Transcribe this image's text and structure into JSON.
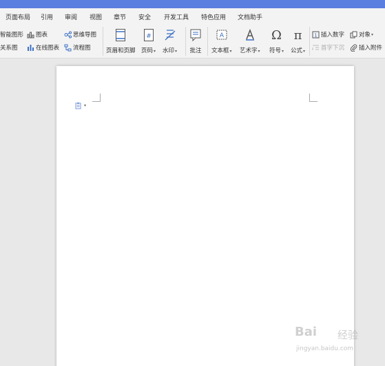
{
  "menu": {
    "tabs": [
      "页面布局",
      "引用",
      "审阅",
      "视图",
      "章节",
      "安全",
      "开发工具",
      "特色应用",
      "文档助手"
    ]
  },
  "ribbon": {
    "smart_shape": "智能图形",
    "relation_chart": "关系图",
    "chart": "图表",
    "online_chart": "在线图表",
    "mind_map": "思维导图",
    "flowchart": "流程图",
    "header_footer": "页眉和页脚",
    "page_number": "页码",
    "watermark": "水印",
    "comment": "批注",
    "text_box": "文本框",
    "word_art": "艺术字",
    "symbol": "符号",
    "formula": "公式",
    "insert_number": "插入数字",
    "object": "对象",
    "first_letter_sink": "首字下沉",
    "insert_attachment": "插入附件"
  },
  "document": {
    "paste_options_icon": "paste-options-icon"
  },
  "watermark": {
    "logo": "Bai",
    "logo_cn": "经验",
    "url": "jingyan.baidu.com"
  },
  "colors": {
    "title_bar": "#5b7fe0",
    "ribbon_bg": "#f3f3f3",
    "workspace_bg": "#e8e8e8",
    "icon_blue": "#3a6fc4"
  }
}
